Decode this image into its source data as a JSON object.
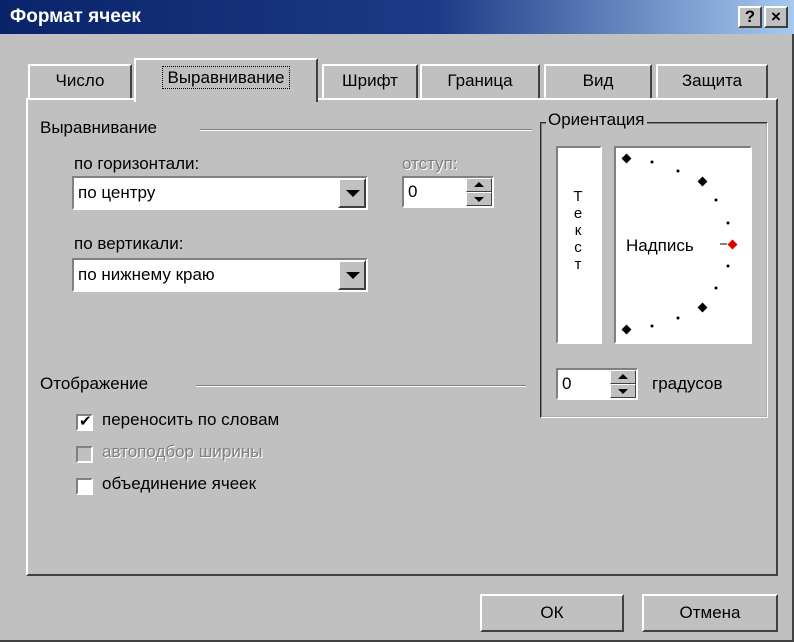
{
  "window": {
    "title": "Формат ячеек",
    "help_button": "?",
    "close_button": "×"
  },
  "tabs": [
    {
      "label": "Число",
      "active": false
    },
    {
      "label": "Выравнивание",
      "active": true
    },
    {
      "label": "Шрифт",
      "active": false
    },
    {
      "label": "Граница",
      "active": false
    },
    {
      "label": "Вид",
      "active": false
    },
    {
      "label": "Защита",
      "active": false
    }
  ],
  "alignment": {
    "group_label": "Выравнивание",
    "horizontal_label": "по горизонтали:",
    "horizontal_value": "по центру",
    "indent_label": "отступ:",
    "indent_value": "0",
    "vertical_label": "по вертикали:",
    "vertical_value": "по нижнему краю"
  },
  "orientation": {
    "group_label": "Ориентация",
    "vertical_text": [
      "Т",
      "е",
      "к",
      "с",
      "т"
    ],
    "caption": "Надпись",
    "degrees_value": "0",
    "degrees_label": "градусов"
  },
  "display": {
    "group_label": "Отображение",
    "wrap_text": {
      "label": "переносить по словам",
      "checked": true,
      "enabled": true
    },
    "shrink_to_fit": {
      "label": "автоподбор ширины",
      "checked": false,
      "enabled": false
    },
    "merge_cells": {
      "label": "объединение ячеек",
      "checked": false,
      "enabled": true
    }
  },
  "buttons": {
    "ok": "ОК",
    "cancel": "Отмена"
  },
  "colors": {
    "titlebar_start": "#0a246a",
    "titlebar_end": "#a6caf0",
    "face": "#c0c0c0",
    "orientation_marker": "#e00000"
  }
}
